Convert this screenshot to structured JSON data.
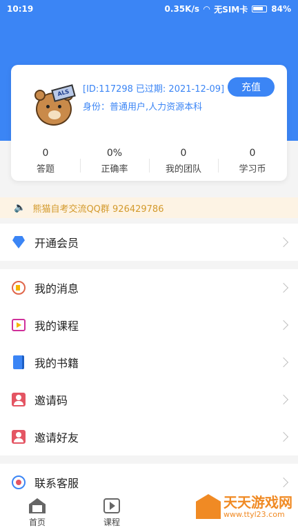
{
  "status": {
    "time": "10:19",
    "speed": "0.35K/s",
    "sim": "无SIM卡",
    "battery": "84%"
  },
  "profile": {
    "id_text": "[ID:117298",
    "expire_text": "已过期: 2021-12-09]",
    "identity_text": "身份：普通用户,人力资源本科",
    "recharge_label": "充值",
    "avatar_hat_text": "ALS"
  },
  "stats": [
    {
      "value": "0",
      "label": "答题"
    },
    {
      "value": "0%",
      "label": "正确率"
    },
    {
      "value": "0",
      "label": "我的团队"
    },
    {
      "value": "0",
      "label": "学习币"
    }
  ],
  "notice": {
    "text": "熊猫自考交流QQ群 926429786"
  },
  "menu": {
    "vip": "开通会员",
    "messages": "我的消息",
    "courses": "我的课程",
    "books": "我的书籍",
    "invite_code": "邀请码",
    "invite_friends": "邀请好友",
    "service": "联系客服"
  },
  "tabs": [
    {
      "label": "首页"
    },
    {
      "label": "课程"
    }
  ],
  "watermark": {
    "title": "天天游戏网",
    "url": "www.ttyl23.com"
  },
  "colors": {
    "primary": "#3b85f5",
    "notice_bg": "#fdf3e4",
    "notice_text": "#d39a2c"
  }
}
